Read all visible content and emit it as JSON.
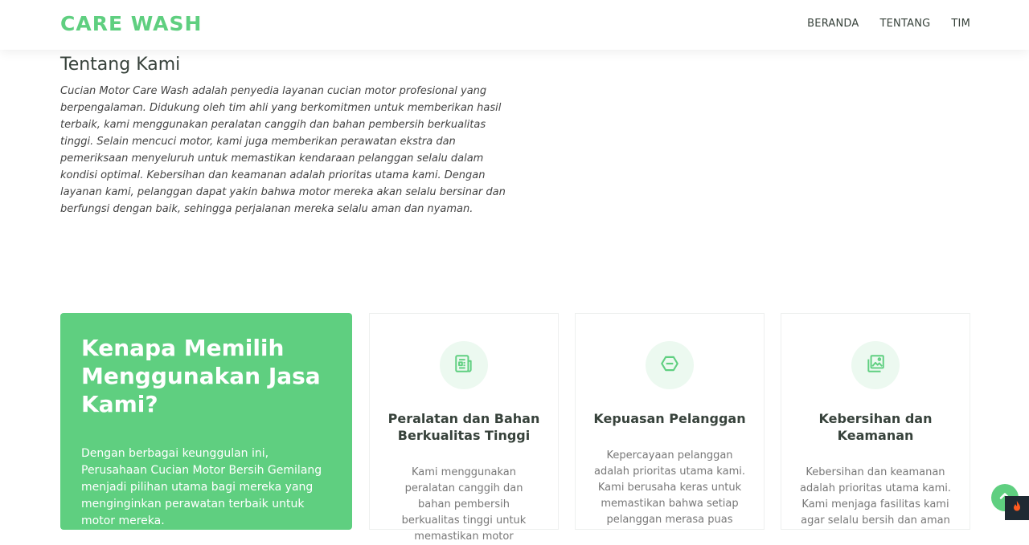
{
  "header": {
    "logo": "CARE WASH",
    "nav": [
      "BERANDA",
      "TENTANG",
      "TIM"
    ]
  },
  "about": {
    "title": "Tentang Kami",
    "text": "Cucian Motor Care Wash adalah penyedia layanan cucian motor profesional yang berpengalaman. Didukung oleh tim ahli yang berkomitmen untuk memberikan hasil terbaik, kami menggunakan peralatan canggih dan bahan pembersih berkualitas tinggi. Selain mencuci motor, kami juga memberikan perawatan ekstra dan pemeriksaan menyeluruh untuk memastikan kendaraan pelanggan selalu dalam kondisi optimal. Kebersihan dan keamanan adalah prioritas utama kami. Dengan layanan kami, pelanggan dapat yakin bahwa motor mereka akan selalu bersinar dan berfungsi dengan baik, sehingga perjalanan mereka selalu aman dan nyaman."
  },
  "why": {
    "title": "Kenapa Memilih Menggunakan Jasa Kami?",
    "text": "Dengan berbagai keunggulan ini, Perusahaan Cucian Motor Bersih Gemilang menjadi pilihan utama bagi mereka yang menginginkan perawatan terbaik untuk motor mereka."
  },
  "features": [
    {
      "icon": "newspaper-icon",
      "title": "Peralatan dan Bahan Berkualitas Tinggi",
      "text": "Kami menggunakan peralatan canggih dan bahan pembersih berkualitas tinggi untuk memastikan motor"
    },
    {
      "icon": "hexagon-icon",
      "title": "Kepuasan Pelanggan",
      "text": "Kepercayaan pelanggan adalah prioritas utama kami. Kami berusaha keras untuk memastikan bahwa setiap pelanggan merasa puas"
    },
    {
      "icon": "images-icon",
      "title": "Kebersihan dan Keamanan",
      "text": "Kebersihan dan keamanan adalah prioritas utama kami. Kami menjaga fasilitas kami agar selalu bersih dan aman"
    }
  ],
  "colors": {
    "accent": "#5fcf80",
    "icon_bg": "#ecf9f0",
    "heading": "#37423b"
  }
}
